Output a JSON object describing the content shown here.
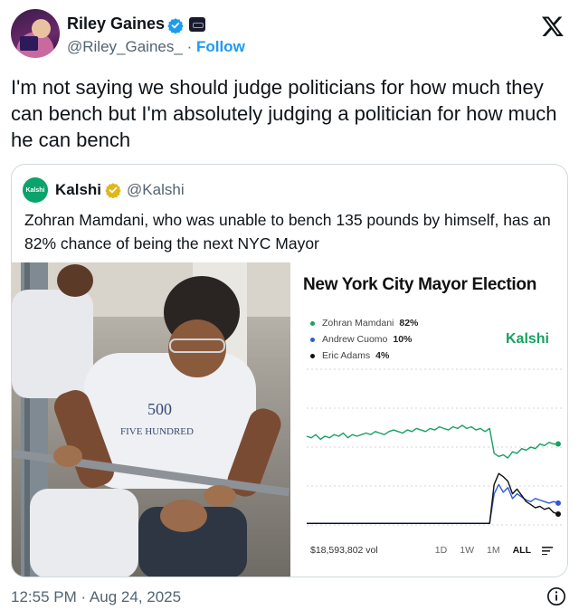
{
  "author": {
    "name": "Riley Gaines",
    "handle": "@Riley_Gaines_",
    "separator": "·",
    "follow_label": "Follow"
  },
  "tweet": {
    "text": "I'm not saying we should judge politicians for how much they can bench but I'm absolutely judging a politician for how much he can bench",
    "timestamp": "12:55 PM · Aug 24, 2025"
  },
  "quote": {
    "avatar_text": "Kalshi",
    "name": "Kalshi",
    "handle": "@Kalshi",
    "text": "Zohran Mamdani, who was unable to bench 135 pounds by himself, has an 82% chance of being the next NYC Mayor"
  },
  "chart_panel": {
    "title": "New York City Mayor Election",
    "brand": "Kalshi",
    "volume": "$18,593,802 vol",
    "ranges": [
      "1D",
      "1W",
      "1M",
      "ALL"
    ],
    "active_range": "ALL"
  },
  "chart_data": {
    "type": "line",
    "title": "New York City Mayor Election",
    "xlabel": "",
    "ylabel": "",
    "ylim": [
      0,
      100
    ],
    "grid": true,
    "legend_position": "top-left",
    "series": [
      {
        "name": "Zohran Mamdani",
        "label": "82%",
        "color": "#17a160",
        "values": [
          57,
          56,
          58,
          55,
          57,
          56,
          58,
          57,
          59,
          56,
          58,
          57,
          58,
          59,
          58,
          60,
          59,
          58,
          60,
          61,
          60,
          59,
          61,
          60,
          62,
          61,
          60,
          62,
          61,
          63,
          62,
          61,
          63,
          62,
          64,
          62,
          63,
          61,
          62,
          60,
          62,
          46,
          44,
          45,
          43,
          47,
          46,
          49,
          48,
          50,
          49,
          52,
          51,
          53,
          52,
          52
        ]
      },
      {
        "name": "Andrew Cuomo",
        "label": "10%",
        "color": "#2f5bd3",
        "values": [
          1,
          1,
          1,
          1,
          1,
          1,
          1,
          1,
          1,
          1,
          1,
          1,
          1,
          1,
          1,
          1,
          1,
          1,
          1,
          1,
          1,
          1,
          1,
          1,
          1,
          1,
          1,
          1,
          1,
          1,
          1,
          1,
          1,
          1,
          1,
          1,
          1,
          1,
          1,
          1,
          1,
          20,
          26,
          21,
          24,
          17,
          20,
          18,
          16,
          15,
          17,
          16,
          15,
          14,
          15,
          14
        ]
      },
      {
        "name": "Eric Adams",
        "label": "4%",
        "color": "#111111",
        "values": [
          1,
          1,
          1,
          1,
          1,
          1,
          1,
          1,
          1,
          1,
          1,
          1,
          1,
          1,
          1,
          1,
          1,
          1,
          1,
          1,
          1,
          1,
          1,
          1,
          1,
          1,
          1,
          1,
          1,
          1,
          1,
          1,
          1,
          1,
          1,
          1,
          1,
          1,
          1,
          1,
          1,
          26,
          33,
          31,
          28,
          20,
          23,
          19,
          15,
          13,
          11,
          12,
          10,
          11,
          8,
          7
        ]
      }
    ]
  }
}
